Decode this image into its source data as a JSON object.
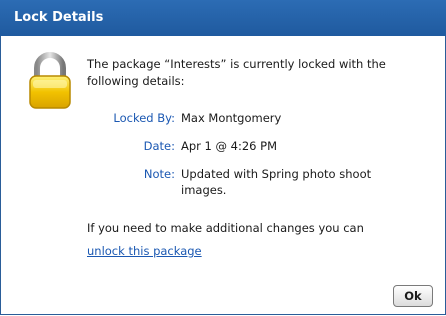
{
  "dialog": {
    "title": "Lock Details",
    "intro": "The package “Interests” is currently locked with the following details:",
    "fields": [
      {
        "label": "Locked By:",
        "value": "Max Montgomery"
      },
      {
        "label": "Date:",
        "value": "Apr 1 @ 4:26 PM"
      },
      {
        "label": "Note:",
        "value": "Updated with Spring photo shoot images."
      }
    ],
    "footer_text": "If you need to make additional changes you can",
    "unlock_link": "unlock this package",
    "ok_label": "Ok",
    "icon": "padlock-icon"
  },
  "colors": {
    "titlebar": "#1f5a9f",
    "label": "#1b58b2",
    "link": "#1b58b2",
    "lock_body": "#f2c200"
  }
}
